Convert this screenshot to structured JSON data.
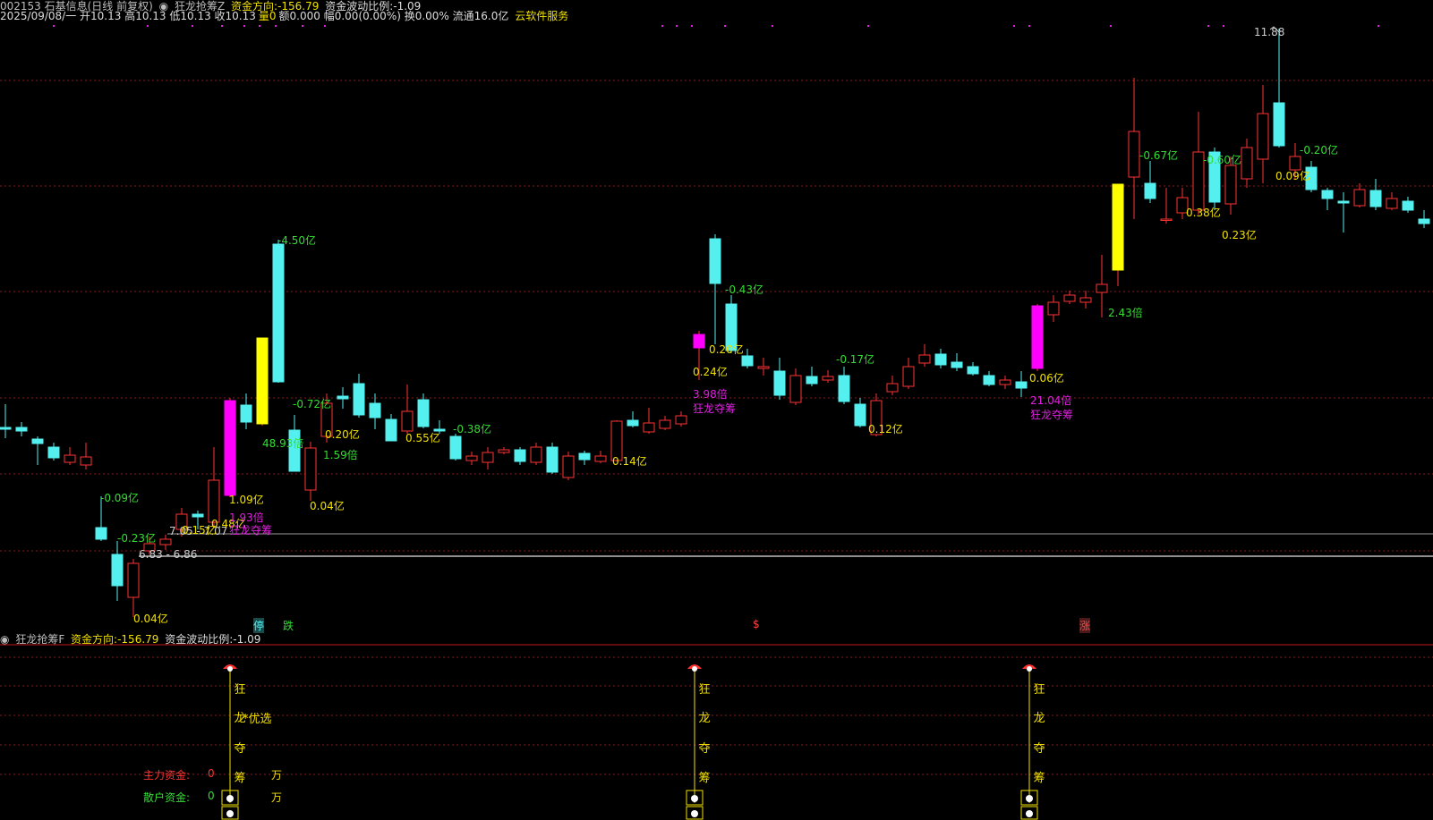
{
  "header": {
    "code_name": "002153 石基信息(日线 前复权)",
    "indicator": "狂龙抢筹Z",
    "fund_dir_label": "资金方向:",
    "fund_dir_value": "-156.79",
    "fund_vol_label": "资金波动比例:",
    "fund_vol_value": "-1.09",
    "line2": "2025/09/08/一 开10.13 高10.13 低10.13 收10.13",
    "vol_label": "量0",
    "line2b": "额0.000 幅0.00(0.00%) 换0.00% 流通16.0亿",
    "brand": "云软件服务"
  },
  "lower_header": {
    "indicator": "狂龙抢筹F",
    "fund_dir_label": "资金方向:",
    "fund_dir_value": "-156.79",
    "fund_vol_label": "资金波动比例:",
    "fund_vol_value": "-1.09"
  },
  "price_annotations": {
    "high_label": "11.88",
    "range1": "7.05 - 7.07",
    "range2": "6.83 - 6.86"
  },
  "candle_labels": [
    {
      "text": "-0.09亿",
      "color": "#33dd33"
    },
    {
      "text": "-0.23亿",
      "color": "#33dd33"
    },
    {
      "text": "0.15亿",
      "color": "#f0e000"
    },
    {
      "text": "0.48亿",
      "color": "#f0e000"
    },
    {
      "text": "0.04亿",
      "color": "#f0e000"
    },
    {
      "text": "1.09亿",
      "color": "#f0e000"
    },
    {
      "text": "1.93倍",
      "color": "#e020e0"
    },
    {
      "text": "狂龙夺筹",
      "color": "#e020e0"
    },
    {
      "text": "-4.50亿",
      "color": "#33dd33"
    },
    {
      "text": "48.93倍",
      "color": "#33dd33"
    },
    {
      "text": "-0.72亿",
      "color": "#33dd33"
    },
    {
      "text": "0.20亿",
      "color": "#f0e000"
    },
    {
      "text": "1.59倍",
      "color": "#33dd33"
    },
    {
      "text": "0.04亿",
      "color": "#f0e000"
    },
    {
      "text": "0.55亿",
      "color": "#f0e000"
    },
    {
      "text": "-0.38亿",
      "color": "#33dd33"
    },
    {
      "text": "0.14亿",
      "color": "#f0e000"
    },
    {
      "text": "-0.43亿",
      "color": "#33dd33"
    },
    {
      "text": "0.20亿",
      "color": "#f0e000"
    },
    {
      "text": "0.24亿",
      "color": "#f0e000"
    },
    {
      "text": "3.98倍",
      "color": "#e020e0"
    },
    {
      "text": "狂龙夺筹",
      "color": "#e020e0"
    },
    {
      "text": "-0.17亿",
      "color": "#33dd33"
    },
    {
      "text": "0.12亿",
      "color": "#f0e000"
    },
    {
      "text": "0.06亿",
      "color": "#f0e000"
    },
    {
      "text": "21.04倍",
      "color": "#e020e0"
    },
    {
      "text": "狂龙夺筹",
      "color": "#e020e0"
    },
    {
      "text": "2.43倍",
      "color": "#33dd33"
    },
    {
      "text": "-0.67亿",
      "color": "#33dd33"
    },
    {
      "text": "-0.60亿",
      "color": "#33dd33"
    },
    {
      "text": "0.38亿",
      "color": "#f0e000"
    },
    {
      "text": "0.23亿",
      "color": "#f0e000"
    },
    {
      "text": "0.09亿",
      "color": "#f0e000"
    },
    {
      "text": "-0.20亿",
      "color": "#33dd33"
    }
  ],
  "markers": [
    "停",
    "跌",
    "$",
    "涨"
  ],
  "signal_text": [
    "狂",
    "龙",
    "夺",
    "筹"
  ],
  "signal_extra": "优选",
  "legend": {
    "main_label": "主力资金:",
    "main_value": "0",
    "main_unit": "万",
    "retail_label": "散户资金:",
    "retail_value": "0",
    "retail_unit": "万"
  },
  "colors": {
    "up": "#ff3333",
    "down": "#54f0f0",
    "signal": "#ff00ff",
    "strong": "#ffff00",
    "grid": "#8a1a1a",
    "gain": "#f0e000",
    "loss": "#33dd33"
  }
}
